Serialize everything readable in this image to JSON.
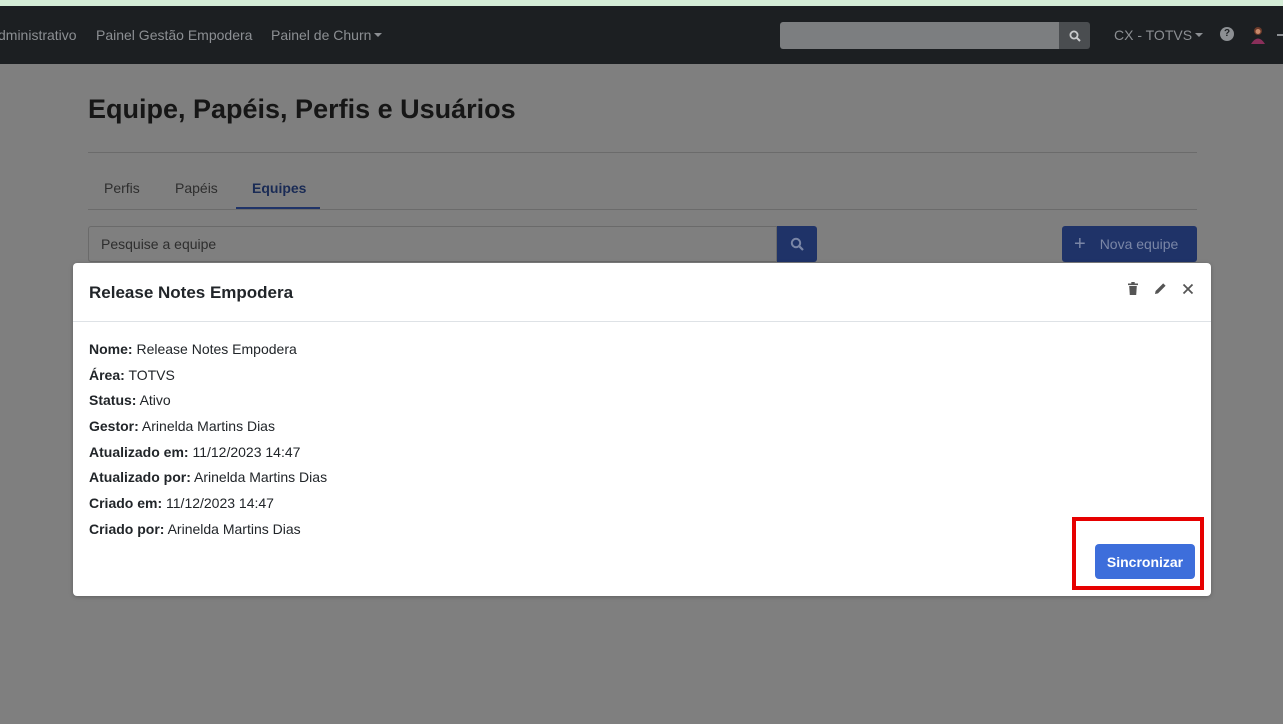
{
  "navbar": {
    "links": [
      "dministrativo",
      "Painel Gestão Empodera",
      "Painel de Churn"
    ],
    "search_placeholder": "",
    "org_menu": "CX - TOTVS",
    "help_symbol": "?",
    "icons": [
      "search-icon",
      "chevron-down-icon",
      "help-icon",
      "avatar"
    ]
  },
  "page": {
    "title": "Equipe, Papéis, Perfis e Usuários",
    "tabs": [
      {
        "label": "Perfis",
        "active": false
      },
      {
        "label": "Papéis",
        "active": false
      },
      {
        "label": "Equipes",
        "active": true
      }
    ],
    "search_placeholder": "Pesquise a equipe",
    "new_team_label": "Nova equipe"
  },
  "modal": {
    "title": "Release Notes Empodera",
    "header_icons": [
      "trash-icon",
      "pencil-icon",
      "close-icon"
    ],
    "fields": [
      {
        "label": "Nome:",
        "value": "Release Notes Empodera"
      },
      {
        "label": "Área:",
        "value": "TOTVS"
      },
      {
        "label": "Status:",
        "value": "Ativo"
      },
      {
        "label": "Gestor:",
        "value": "Arinelda Martins Dias"
      },
      {
        "label": "Atualizado em:",
        "value": "11/12/2023 14:47"
      },
      {
        "label": "Atualizado por:",
        "value": "Arinelda Martins Dias"
      },
      {
        "label": "Criado em:",
        "value": "11/12/2023 14:47"
      },
      {
        "label": "Criado por:",
        "value": "Arinelda Martins Dias"
      }
    ],
    "sync_label": "Sincronizar"
  },
  "colors": {
    "navbar_bg": "#1c1f22",
    "primary": "#1f3368",
    "sync_button": "#3d6edb",
    "highlight_border": "#e60000"
  }
}
